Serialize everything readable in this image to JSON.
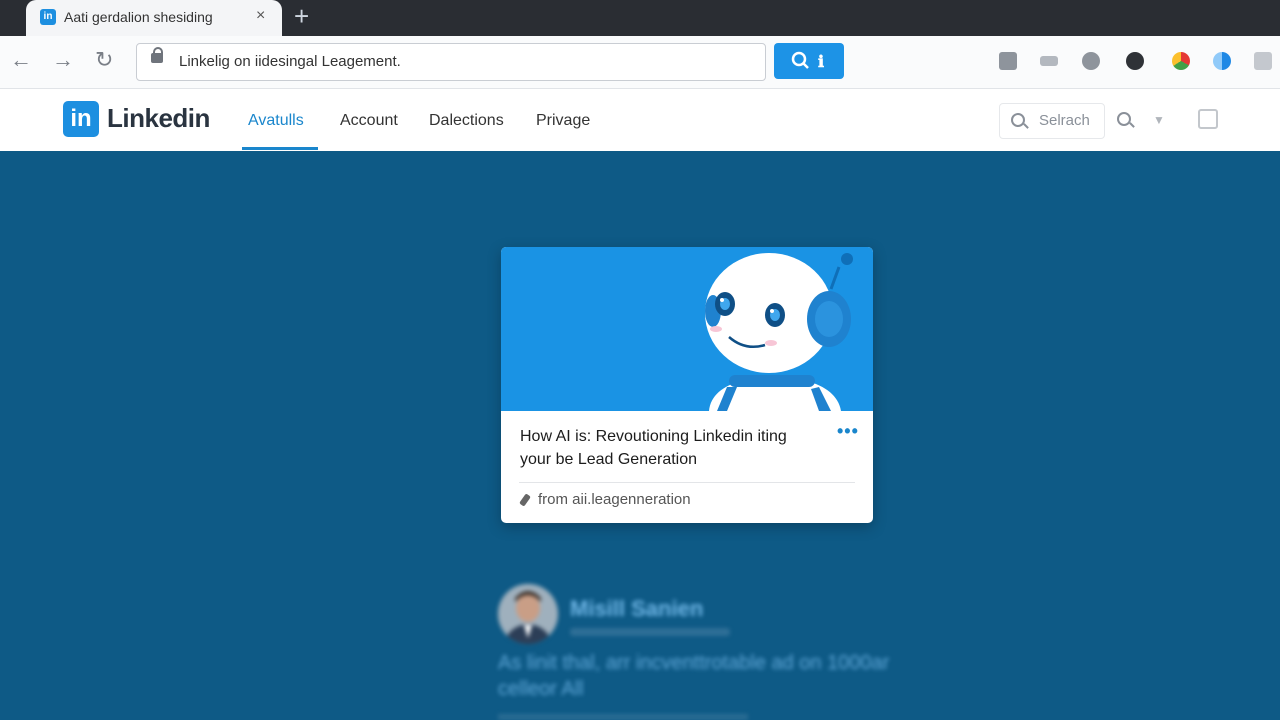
{
  "browser": {
    "tab_title": "Aati gerdalion shesiding",
    "tab_favicon": "in",
    "close_glyph": "×",
    "newtab_glyph": "+",
    "url": "Linkelig on iidesingal Leagement.",
    "go_label": "🔍 ℹ",
    "nav_icons": [
      "back-icon",
      "forward-icon",
      "reload-icon"
    ],
    "extension_icons": [
      "home-icon",
      "share-icon",
      "extension-icon",
      "dark-ext-icon",
      "chrome-icon",
      "color-ext-icon",
      "lock-status-icon"
    ]
  },
  "linkedin": {
    "logo_mark": "in",
    "logo_text": "Linkedin",
    "nav": [
      "Avatulls",
      "Account",
      "Dalections",
      "Privage"
    ],
    "search_label": "Selrach",
    "brand_color": "#1a86cc"
  },
  "card": {
    "title": "How AI is: Revoutioning Linkedin iting your be Lead Generation",
    "more": "•••",
    "source": "from aii.leagenneration"
  },
  "post": {
    "author": "Misill Sanien",
    "text": "As linit thal, arr incventtrotable ad on 1000ar celleor All"
  }
}
